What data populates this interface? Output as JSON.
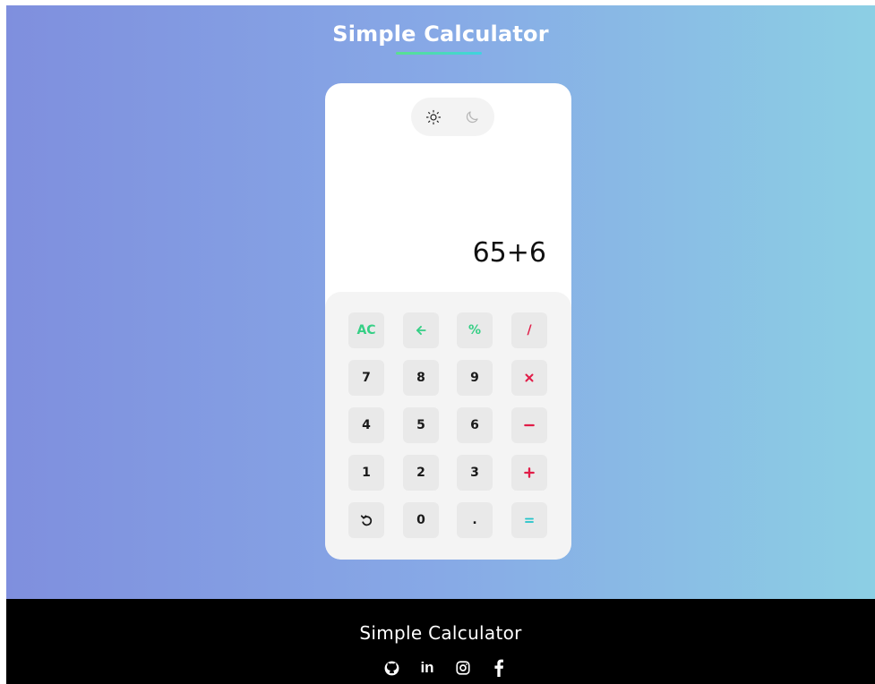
{
  "header": {
    "title": "Simple Calculator"
  },
  "theme_toggle": {
    "options": [
      "sun-icon",
      "moon-icon"
    ],
    "active": "light"
  },
  "display": {
    "expression": "65+6"
  },
  "keypad": {
    "rows": [
      [
        {
          "label": "AC",
          "kind": "function"
        },
        {
          "label": "🡐",
          "icon": "arrow-left-icon",
          "kind": "function"
        },
        {
          "label": "%",
          "kind": "function"
        },
        {
          "label": "/",
          "kind": "operator"
        }
      ],
      [
        {
          "label": "7",
          "kind": "digit"
        },
        {
          "label": "8",
          "kind": "digit"
        },
        {
          "label": "9",
          "kind": "digit"
        },
        {
          "label": "×",
          "icon": "multiply-icon",
          "kind": "operator"
        }
      ],
      [
        {
          "label": "4",
          "kind": "digit"
        },
        {
          "label": "5",
          "kind": "digit"
        },
        {
          "label": "6",
          "kind": "digit"
        },
        {
          "label": "−",
          "icon": "minus-icon",
          "kind": "operator"
        }
      ],
      [
        {
          "label": "1",
          "kind": "digit"
        },
        {
          "label": "2",
          "kind": "digit"
        },
        {
          "label": "3",
          "kind": "digit"
        },
        {
          "label": "+",
          "icon": "plus-icon",
          "kind": "operator"
        }
      ],
      [
        {
          "label": "↺",
          "icon": "undo-icon",
          "kind": "digit"
        },
        {
          "label": "0",
          "kind": "digit"
        },
        {
          "label": ".",
          "kind": "digit"
        },
        {
          "label": "=",
          "icon": "equals-icon",
          "kind": "equals"
        }
      ]
    ]
  },
  "footer": {
    "title": "Simple Calculator",
    "social_icons": [
      "github-icon",
      "linkedin-icon",
      "instagram-icon",
      "facebook-icon"
    ]
  },
  "colors": {
    "function": "#35cf85",
    "operator": "#e11d48",
    "equals": "#22c3c9",
    "key_bg": "#e9e9e9",
    "footer_bg": "#000000"
  }
}
